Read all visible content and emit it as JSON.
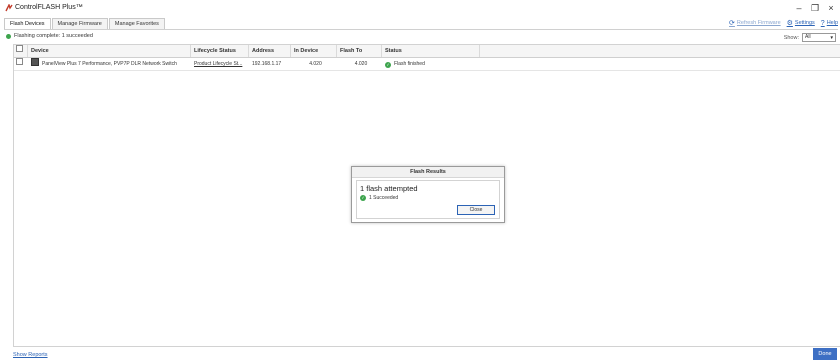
{
  "window": {
    "title": "ControlFLASH Plus™",
    "controls": {
      "minimize": "–",
      "maximize": "❐",
      "close": "×"
    }
  },
  "tabs": [
    {
      "label": "Flash Devices",
      "active": true
    },
    {
      "label": "Manage Firmware",
      "active": false
    },
    {
      "label": "Manage Favorites",
      "active": false
    }
  ],
  "toolbar": {
    "refresh_label": "Refresh Firmware",
    "settings_label": "Settings",
    "help_label": "Help",
    "refresh_icon": "refresh-icon",
    "settings_icon": "gear-icon",
    "help_icon": "question-icon"
  },
  "status": {
    "text": "Flashing complete: 1 succeeded",
    "color": "#3da44d"
  },
  "filter": {
    "label": "Show:",
    "selected": "All"
  },
  "table": {
    "columns": [
      "Device",
      "Lifecycle Status",
      "Address",
      "In Device",
      "Flash To",
      "Status"
    ],
    "rows": [
      {
        "device": "PanelView Plus 7 Performance, PVP7P DLR Network Switch",
        "lifecycle": "Product Lifecycle St...",
        "address": "192.168.1.17",
        "in_device": "4.020",
        "flash_to": "4.020",
        "status": "Flash finished"
      }
    ]
  },
  "dialog": {
    "title": "Flash Results",
    "heading": "1 flash attempted",
    "result": "1 Succeeded",
    "close_label": "Close"
  },
  "footer": {
    "show_reports": "Show Reports",
    "done_label": "Done",
    "accent": "#3d6fc4"
  }
}
